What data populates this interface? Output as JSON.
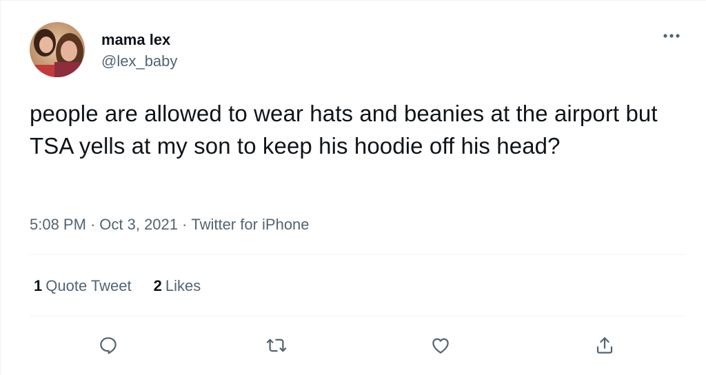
{
  "tweet": {
    "display_name": "mama lex",
    "handle": "@lex_baby",
    "text": "people are allowed to wear hats and beanies at the airport but TSA yells at my son to keep his hoodie off his head?",
    "time": "5:08 PM",
    "date": "Oct 3, 2021",
    "source": "Twitter for iPhone",
    "separator": "·"
  },
  "stats": {
    "quote_count": "1",
    "quote_label": "Quote Tweet",
    "like_count": "2",
    "like_label": "Likes"
  },
  "icons": {
    "more": "more-horizontal-icon",
    "reply": "reply-icon",
    "retweet": "retweet-icon",
    "like": "heart-icon",
    "share": "share-icon"
  },
  "colors": {
    "text_primary": "#0f1419",
    "text_secondary": "#536471",
    "divider": "#eff3f4"
  }
}
